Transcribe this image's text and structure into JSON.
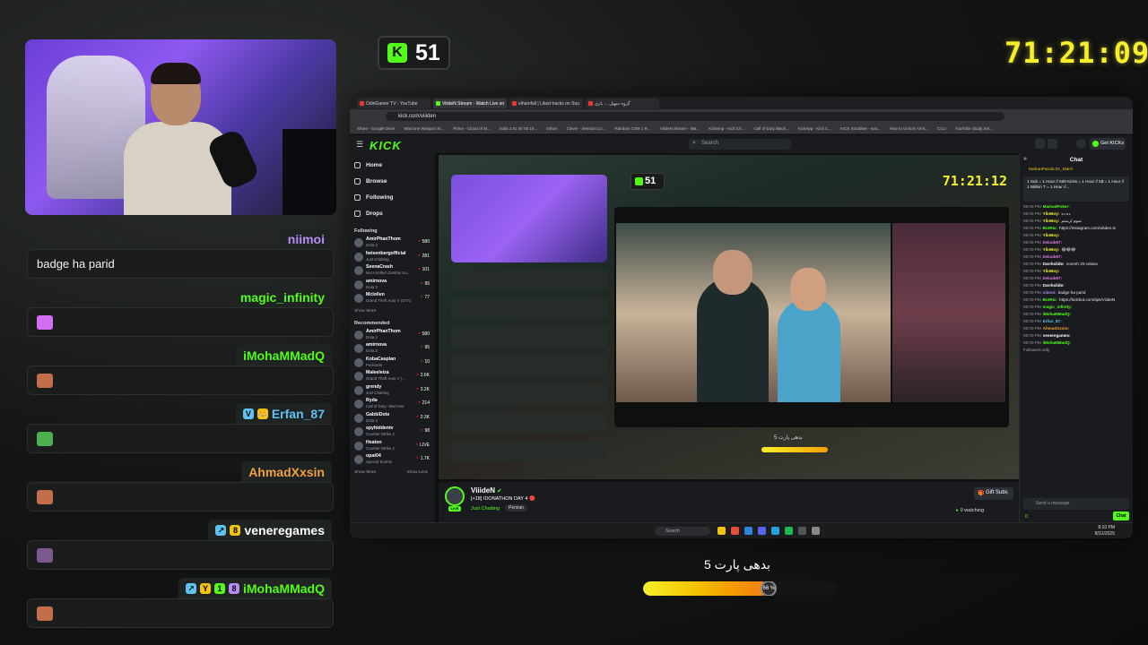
{
  "overlay": {
    "follower_count": "51",
    "kick_icon": "K",
    "timer": "71:21:09",
    "goal_caption": "بدهی پارت 5",
    "goal_progress_fraction": 0.65,
    "goal_knob_label": "66 %",
    "colors": {
      "kick_green": "#53fc18",
      "timer_yellow": "#f7ef2b"
    }
  },
  "chat_overlay": [
    {
      "user": "niimoi",
      "color": "#b98cf5",
      "badges": [],
      "text": "badge ha parid",
      "emote": ""
    },
    {
      "user": "magic_infinity",
      "color": "#53fc18",
      "badges": [],
      "text": "",
      "emote": "purple-emote"
    },
    {
      "user": "iMohaMMadQ",
      "color": "#53fc18",
      "badges": [],
      "text": "",
      "emote": "face-emote"
    },
    {
      "user": "Erfan_87",
      "color": "#5ec3f2",
      "badges": [
        "V",
        "👑"
      ],
      "text": "",
      "emote": "frog-emote"
    },
    {
      "user": "AhmadXxsin",
      "color": "#f0a040",
      "badges": [],
      "text": "",
      "emote": "face-emote"
    },
    {
      "user": "veneregames",
      "color": "#ffffff",
      "badges": [
        "↗",
        "8"
      ],
      "text": "",
      "emote": "girl-emote"
    },
    {
      "user": "iMohaMMadQ",
      "color": "#53fc18",
      "badges": [
        "↗",
        "Y",
        "1",
        "8"
      ],
      "text": "",
      "emote": "face-emote"
    }
  ],
  "browser": {
    "tabs": [
      "OdinGamer TV - YouTube",
      "ViiideN Stream - Watch Live on",
      "elhamfall | Liked tracks on Sou",
      "گروه سهیل ... بازی"
    ],
    "url": "kick.com/viiiden",
    "bookmarks": [
      "Share - Google Drive",
      "Warzone Weapon St...",
      "Prime - Cloud of St...",
      "bulla 1 01 50 50 10...",
      "mthon",
      "Clever - Session Co...",
      "Random CSM 1 R...",
      "ViiideN Stream - Wa...",
      "Kickemp - Kick Ch...",
      "Call of Duty Black...",
      "KickApp - Kick C...",
      "KICK Scrubber - war...",
      "How to Unlock All N...",
      "CCU",
      "YouTube Study Set..."
    ],
    "search_placeholder": "Search",
    "get_kicks": "Get KICKs",
    "nav": [
      "Home",
      "Browse",
      "Following",
      "Drops"
    ],
    "following_heading": "Following",
    "following": [
      {
        "name": "AmirPhanThom",
        "game": "Dota 2",
        "viewers": "580"
      },
      {
        "name": "heisenbergofficial",
        "game": "Just Chatting",
        "viewers": "281"
      },
      {
        "name": "SeenaCrash",
        "game": "Not Another Zombie Su...",
        "viewers": "101"
      },
      {
        "name": "amirnova",
        "game": "Dota 2",
        "viewers": "95"
      },
      {
        "name": "Mclollen",
        "game": "Grand Theft Auto V (GTA)",
        "viewers": "77"
      }
    ],
    "show_more": "Show More",
    "recommended_heading": "Recommended",
    "recommended": [
      {
        "name": "AmirPhanThom",
        "game": "Dota 2",
        "viewers": "580"
      },
      {
        "name": "amirnova",
        "game": "Dota 2",
        "viewers": "95"
      },
      {
        "name": "KobaCasplan",
        "game": "Podcasts",
        "viewers": "10"
      },
      {
        "name": "Maleeleiza",
        "game": "Grand Theft Auto V (...",
        "viewers": "2.6K"
      },
      {
        "name": "grendy",
        "game": "Just Chatting",
        "viewers": "3.2K"
      },
      {
        "name": "Ryda",
        "game": "Call of Duty: Warzone",
        "viewers": "214"
      },
      {
        "name": "GabbiDots",
        "game": "Dota 2",
        "viewers": "2.3K"
      },
      {
        "name": "spyhiddentv",
        "game": "Counter-Strike 2",
        "viewers": "98"
      },
      {
        "name": "Heaton",
        "game": "Counter-Strike 2",
        "viewers": "LIVE"
      },
      {
        "name": "opat04",
        "game": "Special Events",
        "viewers": "1.7K"
      }
    ],
    "show_less": "Show Less",
    "stream": {
      "channel": "ViiideN",
      "title": "[+18] IDONATHON DAY 4 🔴",
      "category": "Just Chatting",
      "tag": "Persian",
      "gift_subs": "Gift Subs",
      "watching": "0 watching",
      "live": "LIVE",
      "inner_counter": "51",
      "inner_timer": "71:21:12",
      "inner_goal_caption": "بدهی پارت 5"
    },
    "chat": {
      "title": "Chat",
      "pinned_users": "MahanPanda  Dr_MaHi",
      "pinned_text": "1 Sub = 1 Hour // 500 Kicks = 1 Hour // 5$ = 1 Hour // 1 Million T = 1 Hour //...",
      "lines": [
        {
          "time": "08:08 PM",
          "user": "MamadPoker:",
          "color": "#53fc18",
          "text": ""
        },
        {
          "time": "08:08 PM",
          "user": "YlinBoy:",
          "color": "#f7ef2b",
          "text": "ده ده"
        },
        {
          "time": "08:08 PM",
          "user": "YlinBoy:",
          "color": "#f7ef2b",
          "text": "شوم لرستم"
        },
        {
          "time": "08:08 PM",
          "user": "BotRix:",
          "color": "#53fc18",
          "text": "https://instagram.com/viiiden.tv"
        },
        {
          "time": "08:08 PM",
          "user": "YlinBoy:",
          "color": "#f7ef2b",
          "text": ""
        },
        {
          "time": "08:08 PM",
          "user": "Zeinab97:",
          "color": "#e47cf0",
          "text": ""
        },
        {
          "time": "08:09 PM",
          "user": "YlinBoy:",
          "color": "#f7ef2b",
          "text": "😂😂😂"
        },
        {
          "time": "08:09 PM",
          "user": "Zeinab97:",
          "color": "#e47cf0",
          "text": ""
        },
        {
          "time": "08:09 PM",
          "user": "Darrkslide:",
          "color": "#ffffff",
          "text": "nonreh 20 celaso"
        },
        {
          "time": "08:09 PM",
          "user": "YlinBoy:",
          "color": "#f7ef2b",
          "text": ""
        },
        {
          "time": "08:09 PM",
          "user": "Zeinab97:",
          "color": "#e47cf0",
          "text": ""
        },
        {
          "time": "08:09 PM",
          "user": "Darrkslide:",
          "color": "#ffffff",
          "text": ""
        },
        {
          "time": "08:09 PM",
          "user": "niimoi:",
          "color": "#b98cf5",
          "text": "badge ha parid"
        },
        {
          "time": "08:09 PM",
          "user": "BotRix:",
          "color": "#53fc18",
          "text": "https://kickbot.com/tips/ViiideN"
        },
        {
          "time": "08:09 PM",
          "user": "magic_infinity:",
          "color": "#53fc18",
          "text": ""
        },
        {
          "time": "08:09 PM",
          "user": "iMohaMMadQ:",
          "color": "#53fc18",
          "text": ""
        },
        {
          "time": "08:09 PM",
          "user": "Erfan_87:",
          "color": "#5ec3f2",
          "text": ""
        },
        {
          "time": "08:09 PM",
          "user": "AhmadXxsin:",
          "color": "#f0a040",
          "text": ""
        },
        {
          "time": "08:09 PM",
          "user": "veneregames:",
          "color": "#ffffff",
          "text": ""
        },
        {
          "time": "08:09 PM",
          "user": "iMohaMMadQ:",
          "color": "#53fc18",
          "text": ""
        }
      ],
      "followers_only": "Followers only",
      "input_placeholder": "Send a message",
      "points": "0",
      "send": "Chat"
    },
    "taskbar": {
      "search": "Search",
      "clock_time": "8:10 PM",
      "clock_date": "8/31/2025"
    }
  }
}
